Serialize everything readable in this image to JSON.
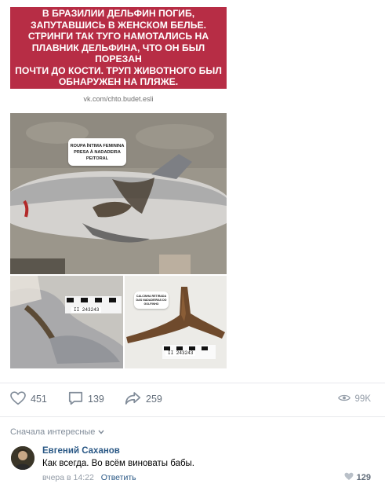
{
  "post": {
    "headline": "В БРАЗИЛИИ ДЕЛЬФИН ПОГИБ,\nЗАПУТАВШИСЬ В ЖЕНСКОМ БЕЛЬЕ.\nСТРИНГИ ТАК ТУГО НАМОТАЛИСЬ НА\nПЛАВНИК ДЕЛЬФИНА, ЧТО ОН БЫЛ ПОРЕЗАН\nПОЧТИ ДО КОСТИ. ТРУП ЖИВОТНОГО БЫЛ\nОБНАРУЖЕН НА ПЛЯЖЕ.",
    "source": "vk.com/chto.budet.esli",
    "photo_caption_main": "ROUPA ÍNTIMA FEMININA\nPRESA À NADADEIRA\nPEITORAL",
    "photo_caption_right": "CALCINHA RETIRADA\nDAS NADADEIRAS DO\nGOLFINHO",
    "scale_label_left": "II 243243",
    "scale_label_right": "II 243243",
    "brand_color": "#b72d45"
  },
  "actions": {
    "likes": "451",
    "comments": "139",
    "shares": "259",
    "views": "99K"
  },
  "comments_section": {
    "sort_label": "Сначала интересные",
    "items": [
      {
        "author": "Евгений Саханов",
        "text": "Как всегда. Во всём виноваты бабы.",
        "time": "вчера в 14:22",
        "reply_label": "Ответить",
        "likes": "129"
      }
    ]
  },
  "icons": [
    "heart-icon",
    "comment-icon",
    "share-icon",
    "eye-icon",
    "chevron-down-icon"
  ]
}
